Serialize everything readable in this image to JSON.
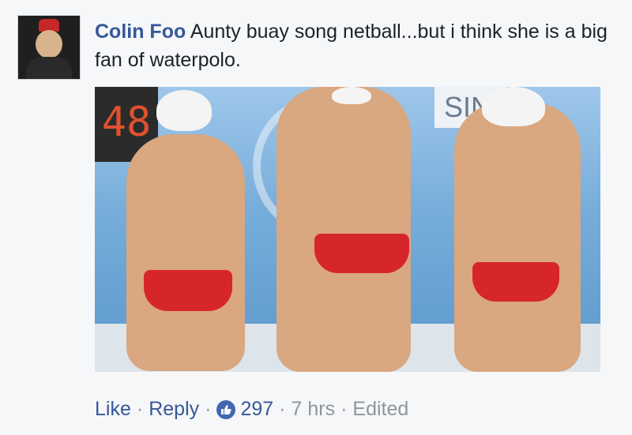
{
  "comment": {
    "author": "Colin Foo",
    "text": "Aunty buay song netball...but i think she is a big fan of waterpolo."
  },
  "photo": {
    "scoreboard": "48",
    "sign": "SIN"
  },
  "actions": {
    "like": "Like",
    "reply": "Reply",
    "separator": "·",
    "reaction_count": "297",
    "time": "7 hrs",
    "edited": "Edited"
  },
  "colors": {
    "link": "#365899",
    "text": "#1d2129",
    "meta": "#90949c",
    "like_badge": "#4267b2"
  }
}
